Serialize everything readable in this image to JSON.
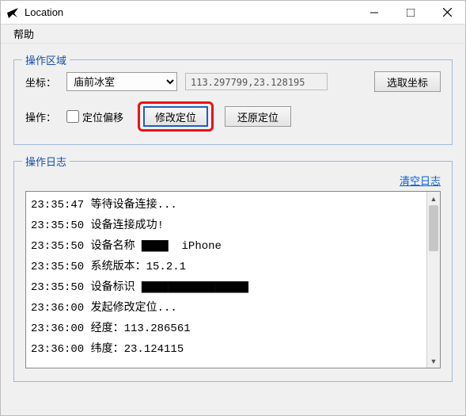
{
  "window": {
    "title": "Location"
  },
  "menu": {
    "help": "帮助"
  },
  "groups": {
    "operate_area": "操作区域",
    "operate_log": "操作日志"
  },
  "labels": {
    "coord": "坐标：",
    "operate": "操作："
  },
  "coord": {
    "selected": "庙前冰室",
    "display": "113.297799,23.128195"
  },
  "buttons": {
    "select_coord": "选取坐标",
    "modify_location": "修改定位",
    "restore_location": "还原定位"
  },
  "checkbox": {
    "offset_label": "定位偏移"
  },
  "log": {
    "clear": "清空日志",
    "lines": [
      "23:35:47 等待设备连接...",
      "23:35:50 设备连接成功!",
      "23:35:50 设备名称 ▇▇▇▇  iPhone",
      "23:35:50 系统版本：15.2.1",
      "23:35:50 设备标识 ▇▇▇▇▇▇▇▇▇▇▇▇▇▇▇▇",
      "23:36:00 发起修改定位...",
      "23:36:00 经度：113.286561",
      "23:36:00 纬度：23.124115"
    ]
  }
}
